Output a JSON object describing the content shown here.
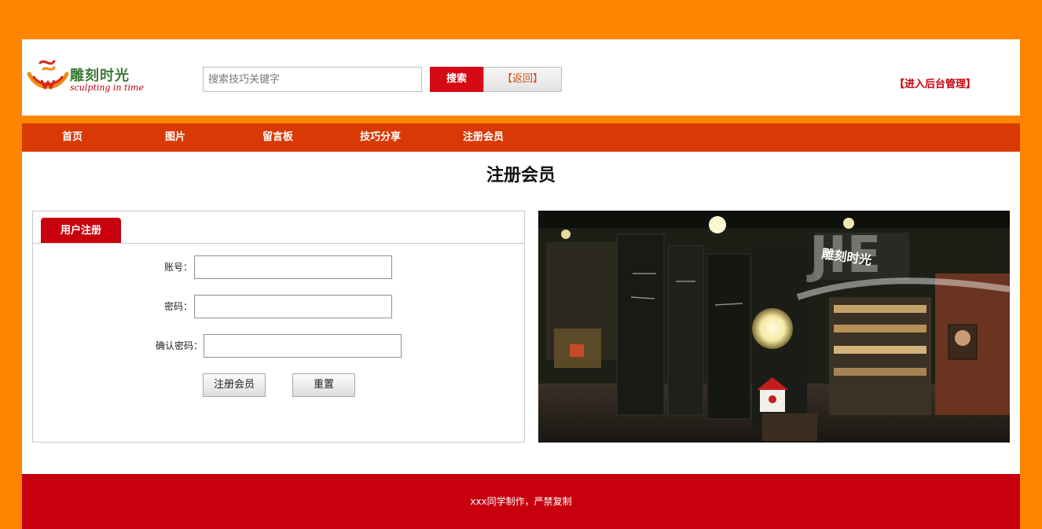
{
  "header": {
    "logo_cn": "雕刻时光",
    "logo_en": "sculpting in time",
    "search_placeholder": "搜索技巧关键字",
    "search_button": "搜索",
    "back_button": "【返回】",
    "admin_link": "【进入后台管理】"
  },
  "nav": {
    "items": [
      {
        "label": "首页"
      },
      {
        "label": "图片"
      },
      {
        "label": "留言板"
      },
      {
        "label": "技巧分享"
      },
      {
        "label": "注册会员"
      }
    ]
  },
  "main": {
    "title": "注册会员",
    "form": {
      "tab_label": "用户注册",
      "account_label": "账号：",
      "password_label": "密码：",
      "confirm_label": "确认密码：",
      "account_value": "",
      "password_value": "",
      "confirm_value": "",
      "submit_label": "注册会员",
      "reset_label": "重置"
    },
    "photo": {
      "sign_text": "雕刻时光",
      "watermark": "JIE"
    }
  },
  "footer": {
    "text": "xxx同学制作，严禁复制"
  },
  "colors": {
    "background": "#ff8400",
    "nav": "#d93a05",
    "accent_red": "#c8000e",
    "search_button": "#d40a15"
  },
  "icons": {
    "logo": "sculpting-in-time-logo-icon"
  }
}
